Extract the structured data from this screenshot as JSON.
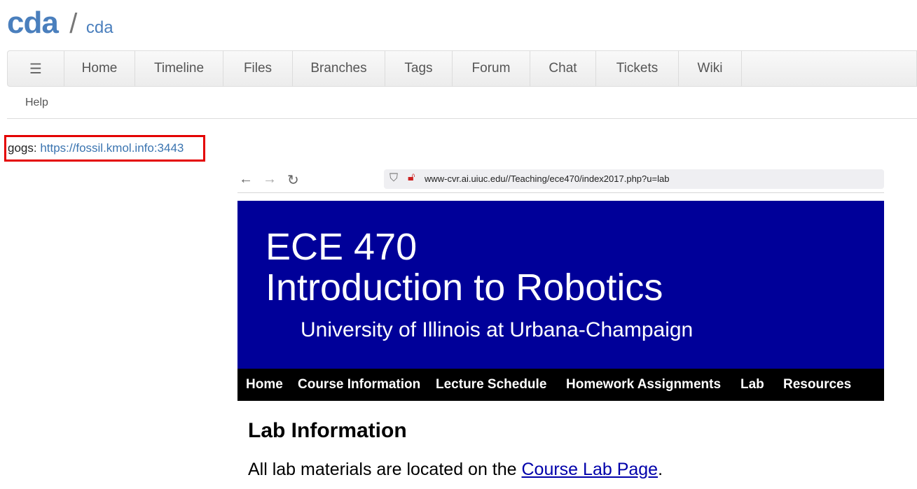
{
  "header": {
    "project": "cda",
    "separator": "/",
    "page": "cda"
  },
  "nav": {
    "menu_icon": "hamburger-icon",
    "items": [
      "Home",
      "Timeline",
      "Files",
      "Branches",
      "Tags",
      "Forum",
      "Chat",
      "Tickets",
      "Wiki"
    ],
    "help": "Help"
  },
  "content": {
    "gogs_label": "gogs:",
    "gogs_link": "https://fossil.kmol.info:3443",
    "highlight_color": "#e40000"
  },
  "screenshot": {
    "toolbar": {
      "back": "←",
      "forward": "→",
      "reload": "↻",
      "url": "www-cvr.ai.uiuc.edu//Teaching/ece470/index2017.php?u=lab"
    },
    "banner": {
      "code": "ECE 470",
      "course": "Introduction to Robotics",
      "university": "University of Illinois at Urbana-Champaign",
      "color": "#000099"
    },
    "menu": [
      "Home",
      "Course Information",
      "Lecture Schedule",
      "Homework Assignments",
      "Lab",
      "Resources"
    ],
    "heading": "Lab Information",
    "text_before": "All lab materials are located on the ",
    "link": "Course Lab Page",
    "text_after": "."
  }
}
